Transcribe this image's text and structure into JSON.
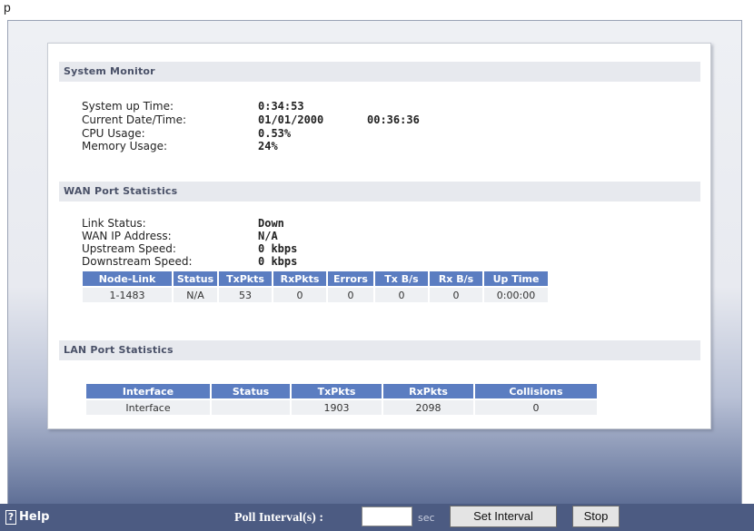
{
  "title_fragment": "p",
  "system_monitor": {
    "header": "System Monitor",
    "rows": [
      {
        "label": "System up Time:",
        "value": "0:34:53"
      },
      {
        "label": "Current Date/Time:",
        "value": "01/01/2000",
        "value2": "00:36:36"
      },
      {
        "label": "CPU Usage:",
        "value": "0.53%"
      },
      {
        "label": "Memory Usage:",
        "value": "24%"
      }
    ]
  },
  "wan": {
    "header": "WAN Port Statistics",
    "rows": [
      {
        "label": "Link Status:",
        "value": "Down"
      },
      {
        "label": "WAN IP Address:",
        "value": "N/A"
      },
      {
        "label": "Upstream Speed:",
        "value": "0 kbps"
      },
      {
        "label": "Downstream Speed:",
        "value": "0 kbps"
      }
    ],
    "table": {
      "columns": [
        "Node-Link",
        "Status",
        "TxPkts",
        "RxPkts",
        "Errors",
        "Tx B/s",
        "Rx B/s",
        "Up Time"
      ],
      "rows": [
        [
          "1-1483",
          "N/A",
          "53",
          "0",
          "0",
          "0",
          "0",
          "0:00:00"
        ]
      ]
    }
  },
  "lan": {
    "header": "LAN Port Statistics",
    "table": {
      "columns": [
        "Interface",
        "Status",
        "TxPkts",
        "RxPkts",
        "Collisions"
      ],
      "rows": [
        [
          "Interface",
          "",
          "1903",
          "2098",
          "0"
        ]
      ]
    }
  },
  "bottom": {
    "help_label": "Help",
    "help_icon": "?",
    "poll_label": "Poll Interval(s) :",
    "poll_value": "",
    "poll_unit": "sec",
    "set_interval_label": "Set Interval",
    "stop_label": "Stop"
  }
}
